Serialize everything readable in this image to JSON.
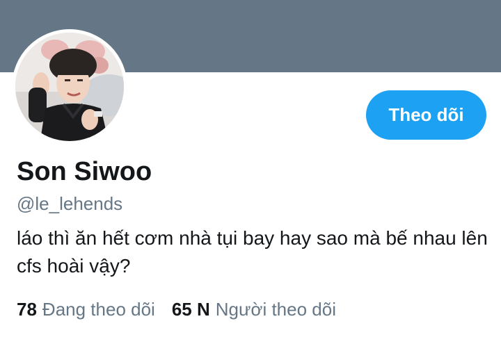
{
  "colors": {
    "banner": "#657786",
    "accent": "#1da1f2",
    "text_primary": "#14171a",
    "text_secondary": "#657786"
  },
  "profile": {
    "display_name": "Son Siwoo",
    "handle": "@le_lehends",
    "bio": "láo thì ăn hết cơm nhà tụi bay hay sao mà bế nhau lên cfs hoài vậy?",
    "avatar_icon": "profile-photo"
  },
  "actions": {
    "follow_label": "Theo dõi"
  },
  "stats": {
    "following_count": "78",
    "following_label": "Đang theo dõi",
    "followers_count": "65 N",
    "followers_label": "Người theo dõi"
  }
}
